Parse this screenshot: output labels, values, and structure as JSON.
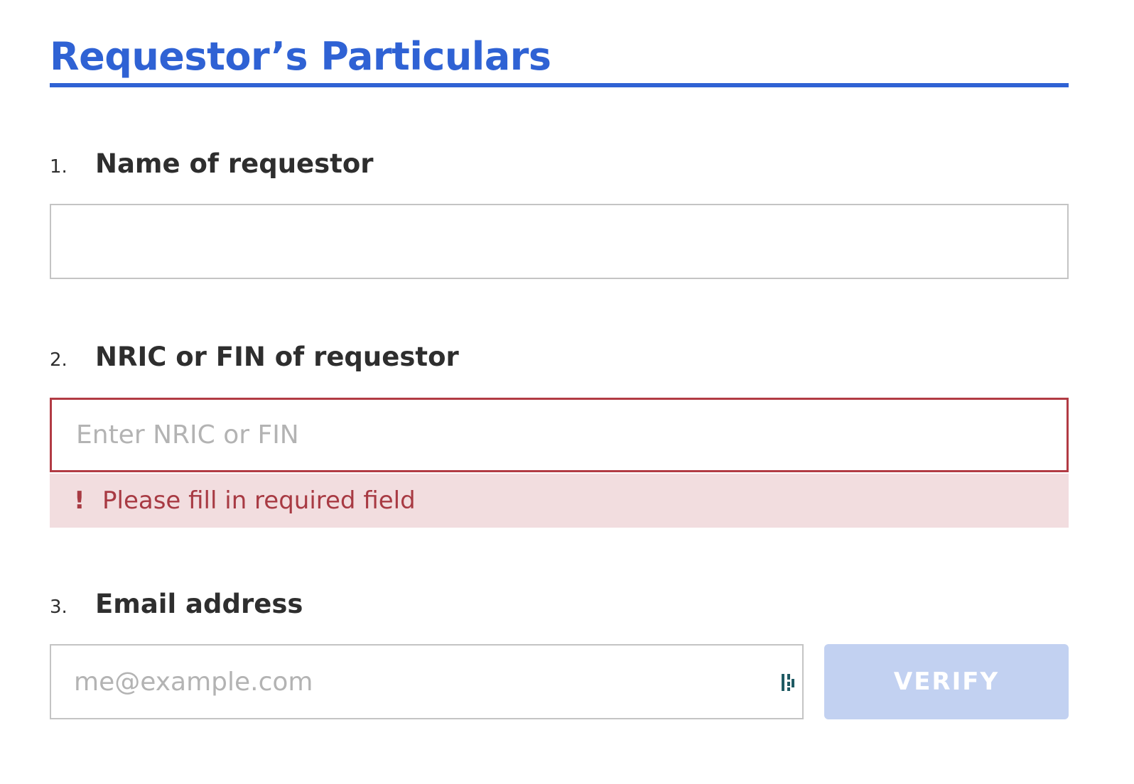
{
  "section": {
    "title": "Requestor’s Particulars"
  },
  "questions": [
    {
      "number": "1.",
      "label": "Name of requestor",
      "value": "",
      "placeholder": ""
    },
    {
      "number": "2.",
      "label": "NRIC or FIN of requestor",
      "value": "",
      "placeholder": "Enter NRIC or FIN",
      "error": {
        "mark": "!",
        "message": "Please fill in required field"
      }
    },
    {
      "number": "3.",
      "label": "Email address",
      "value": "",
      "placeholder": "me@example.com",
      "verify_label": "VERIFY",
      "autofill_icon": "password-manager-icon"
    }
  ],
  "colors": {
    "accent": "#2f62d4",
    "error": "#b23b44",
    "error_background": "#f2dddf",
    "button_disabled": "#c2d1f1"
  }
}
